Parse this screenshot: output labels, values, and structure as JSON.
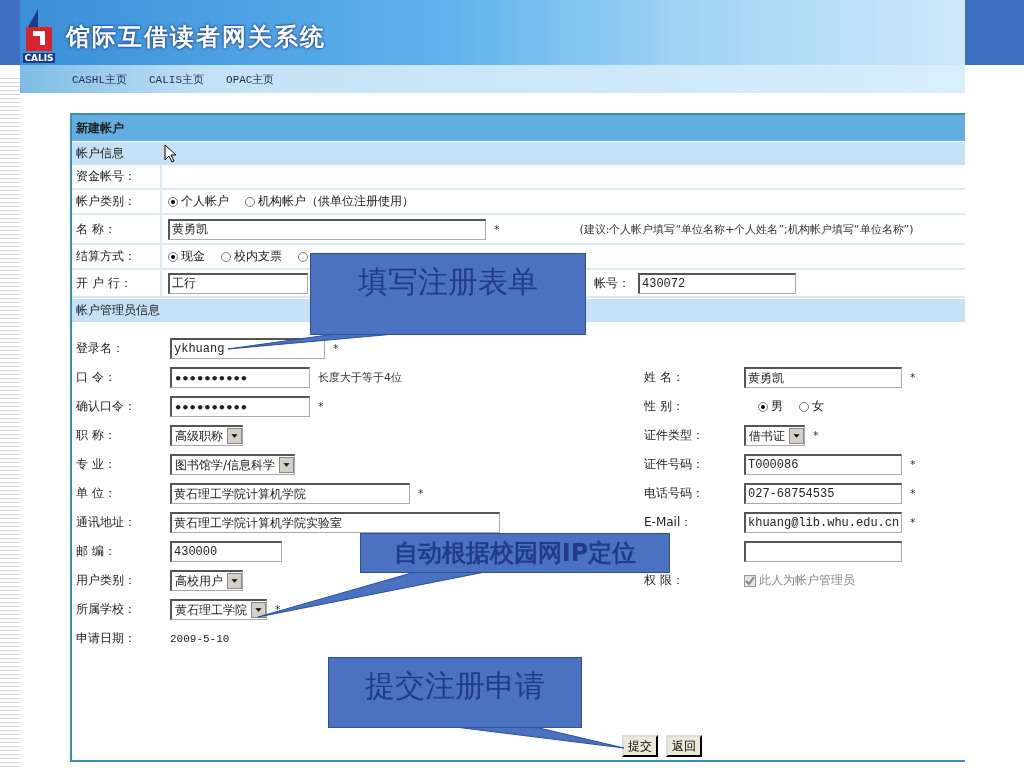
{
  "header": {
    "logo_text": "CALIS",
    "title": "馆际互借读者网关系统"
  },
  "nav": [
    {
      "label": "CASHL主页"
    },
    {
      "label": "CALIS主页"
    },
    {
      "label": "OPAC主页"
    }
  ],
  "form": {
    "title": "新建帐户",
    "account_section": {
      "title": "帐户信息",
      "rows": [
        {
          "label": "资金帐号：",
          "kind": "empty"
        },
        {
          "label": "帐户类别：",
          "kind": "radio",
          "options": [
            {
              "label": "个人帐户",
              "selected": true
            },
            {
              "label": "机构帐户（供单位注册使用）",
              "selected": false
            }
          ]
        },
        {
          "label": "名 称：",
          "kind": "input",
          "value": "黄勇凯",
          "mark": "*",
          "hint": "(建议:个人帐户填写“单位名称+个人姓名”;机构帐户填写“单位名称”)"
        },
        {
          "label": "结算方式：",
          "kind": "radio",
          "options": [
            {
              "label": "现金",
              "selected": true
            },
            {
              "label": "校内支票",
              "selected": false
            },
            {
              "selected": false
            }
          ]
        },
        {
          "label": "开 户 行：",
          "kind": "input",
          "value": "工行",
          "extra": {
            "label": "帐号：",
            "value": "430072"
          }
        }
      ]
    },
    "admin_section": {
      "title": "帐户管理员信息",
      "left": [
        {
          "label": "登录名：",
          "kind": "input",
          "value": "ykhuang",
          "mark": "*"
        },
        {
          "label": "口 令：",
          "kind": "password",
          "value": "••••••••••",
          "note": "长度大于等于4位"
        },
        {
          "label": "确认口令：",
          "kind": "password",
          "value": "••••••••••",
          "mark": "*"
        },
        {
          "label": "职 称：",
          "kind": "select",
          "value": "高级职称"
        },
        {
          "label": "专 业：",
          "kind": "select",
          "value": "图书馆学/信息科学"
        },
        {
          "label": "单 位：",
          "kind": "input",
          "value": "黄石理工学院计算机学院",
          "mark": "*"
        },
        {
          "label": "通讯地址：",
          "kind": "input",
          "value": "黄石理工学院计算机学院实验室"
        },
        {
          "label": "邮 编：",
          "kind": "input",
          "value": "430000"
        },
        {
          "label": "用户类别：",
          "kind": "select",
          "value": "高校用户"
        },
        {
          "label": "所属学校：",
          "kind": "select",
          "value": "黄石理工学院",
          "mark": "*"
        },
        {
          "label": "申请日期：",
          "kind": "text",
          "value": "2009-5-10"
        }
      ],
      "right": [
        {
          "label": "姓 名：",
          "kind": "input",
          "value": "黄勇凯",
          "mark": "*"
        },
        {
          "label": "性 别：",
          "kind": "radio",
          "options": [
            {
              "label": "男",
              "selected": true
            },
            {
              "label": "女",
              "selected": false
            }
          ]
        },
        {
          "label": "证件类型：",
          "kind": "select",
          "value": "借书证",
          "mark": "*"
        },
        {
          "label": "证件号码：",
          "kind": "input",
          "value": "T000086",
          "mark": "*"
        },
        {
          "label": "电话号码：",
          "kind": "input",
          "value": "027-68754535",
          "mark": "*"
        },
        {
          "label": "E-Mail：",
          "kind": "input",
          "value": "khuang@lib.whu.edu.cn",
          "mark": "*"
        },
        {
          "kind": "input"
        },
        {
          "label": "权 限：",
          "kind": "checkbox",
          "text": "此人为帐户管理员",
          "checked": true,
          "disabled": true
        }
      ]
    },
    "buttons": [
      {
        "label": "提交"
      },
      {
        "label": "返回"
      }
    ]
  },
  "callouts": [
    {
      "text": "填写注册表单"
    },
    {
      "text": "自动根据校园网IP定位"
    },
    {
      "text": "提交注册申请"
    }
  ]
}
